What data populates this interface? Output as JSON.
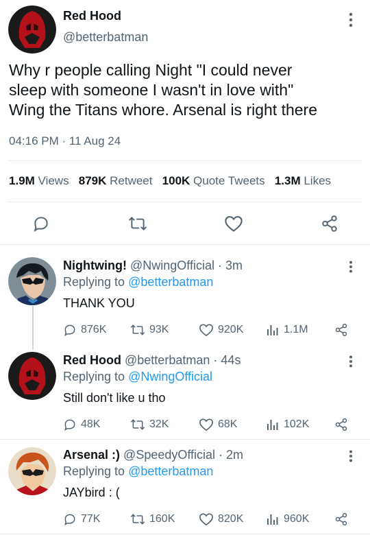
{
  "main_tweet": {
    "display_name": "Red Hood",
    "handle": "@betterbatman",
    "text_lines": [
      "Why r people calling Night \"I could never",
      "sleep with someone I wasn't in love with\"",
      "Wing the Titans whore. Arsenal is right there"
    ],
    "timestamp": "04:16 PM · 11 Aug 24",
    "stats": [
      {
        "value": "1.9M",
        "label": "Views"
      },
      {
        "value": "879K",
        "label": "Retweet"
      },
      {
        "value": "100K",
        "label": "Quote Tweets"
      },
      {
        "value": "1.3M",
        "label": "Likes"
      }
    ]
  },
  "replies": [
    {
      "display_name": "Nightwing!",
      "handle_time": "@NwingOfficial · 3m",
      "replying_prefix": "Replying to",
      "replying_to": "@betterbatman",
      "text": "THANK YOU",
      "replies": "876K",
      "retweets": "93K",
      "likes": "920K",
      "views": "1.1M"
    },
    {
      "display_name": "Red Hood",
      "handle_time": "@betterbatman · 44s",
      "replying_prefix": "Replying to",
      "replying_to": "@NwingOfficial",
      "text": "Still don't like u tho",
      "replies": "48K",
      "retweets": "32K",
      "likes": "68K",
      "views": "102K"
    },
    {
      "display_name": "Arsenal :)",
      "handle_time": "@SpeedyOfficial · 2m",
      "replying_prefix": "Replying to",
      "replying_to": "@betterbatman",
      "text": "JAYbird : (",
      "replies": "77K",
      "retweets": "160K",
      "likes": "820K",
      "views": "960K"
    }
  ],
  "colors": {
    "text": "#0f1419",
    "secondary": "#536471",
    "link": "#1d9bf0",
    "divider": "#e6ecf0"
  }
}
